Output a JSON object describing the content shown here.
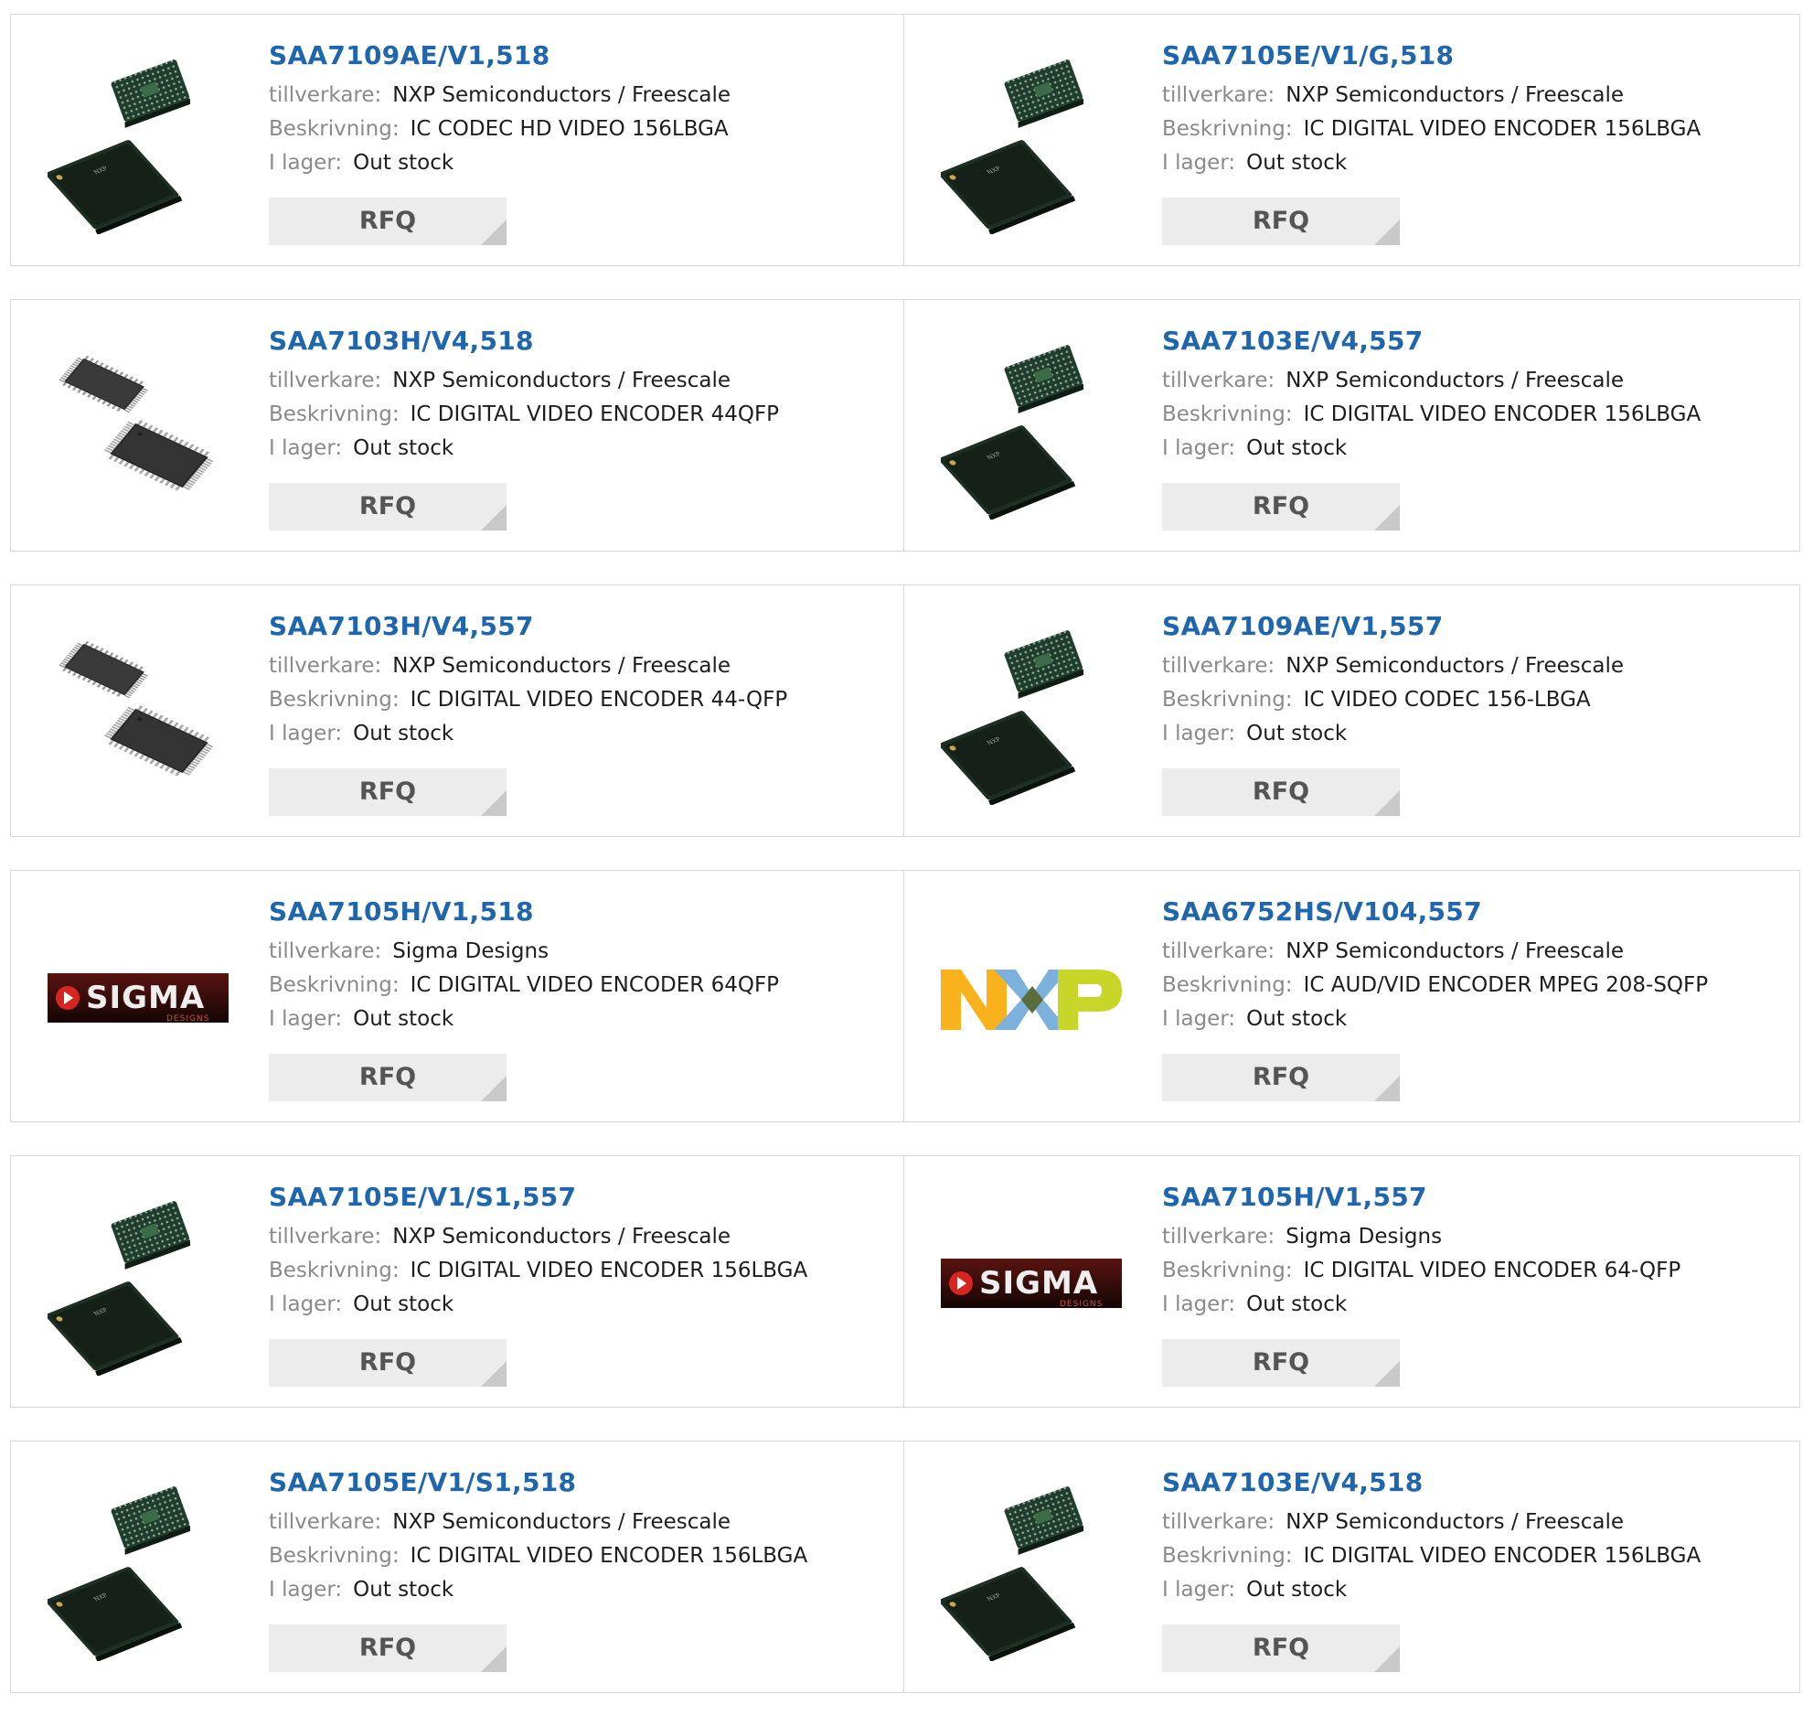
{
  "labels": {
    "manufacturer": "tillverkare:",
    "description": "Beskrivning:",
    "stock": "I lager:",
    "rfq": "RFQ"
  },
  "products": [
    {
      "part": "SAA7109AE/V1,518",
      "manufacturer": "NXP Semiconductors / Freescale",
      "description": "IC CODEC HD VIDEO 156LBGA",
      "stock": "Out stock",
      "image": "bga-chip-icon"
    },
    {
      "part": "SAA7105E/V1/G,518",
      "manufacturer": "NXP Semiconductors / Freescale",
      "description": "IC DIGITAL VIDEO ENCODER 156LBGA",
      "stock": "Out stock",
      "image": "bga-chip-icon"
    },
    {
      "part": "SAA7103H/V4,518",
      "manufacturer": "NXP Semiconductors / Freescale",
      "description": "IC DIGITAL VIDEO ENCODER 44QFP",
      "stock": "Out stock",
      "image": "qfp-chip-icon"
    },
    {
      "part": "SAA7103E/V4,557",
      "manufacturer": "NXP Semiconductors / Freescale",
      "description": "IC DIGITAL VIDEO ENCODER 156LBGA",
      "stock": "Out stock",
      "image": "bga-chip-icon"
    },
    {
      "part": "SAA7103H/V4,557",
      "manufacturer": "NXP Semiconductors / Freescale",
      "description": "IC DIGITAL VIDEO ENCODER 44-QFP",
      "stock": "Out stock",
      "image": "qfp-chip-icon"
    },
    {
      "part": "SAA7109AE/V1,557",
      "manufacturer": "NXP Semiconductors / Freescale",
      "description": "IC VIDEO CODEC 156-LBGA",
      "stock": "Out stock",
      "image": "bga-chip-icon"
    },
    {
      "part": "SAA7105H/V1,518",
      "manufacturer": "Sigma Designs",
      "description": "IC DIGITAL VIDEO ENCODER 64QFP",
      "stock": "Out stock",
      "image": "sigma-designs-logo",
      "logo_text": "SIGMA",
      "logo_subtext": "DESIGNS"
    },
    {
      "part": "SAA6752HS/V104,557",
      "manufacturer": "NXP Semiconductors / Freescale",
      "description": "IC AUD/VID ENCODER MPEG 208-SQFP",
      "stock": "Out stock",
      "image": "nxp-logo",
      "logo_text": "NXP"
    },
    {
      "part": "SAA7105E/V1/S1,557",
      "manufacturer": "NXP Semiconductors / Freescale",
      "description": "IC DIGITAL VIDEO ENCODER 156LBGA",
      "stock": "Out stock",
      "image": "bga-chip-icon"
    },
    {
      "part": "SAA7105H/V1,557",
      "manufacturer": "Sigma Designs",
      "description": "IC DIGITAL VIDEO ENCODER 64-QFP",
      "stock": "Out stock",
      "image": "sigma-designs-logo",
      "logo_text": "SIGMA",
      "logo_subtext": "DESIGNS"
    },
    {
      "part": "SAA7105E/V1/S1,518",
      "manufacturer": "NXP Semiconductors / Freescale",
      "description": "IC DIGITAL VIDEO ENCODER 156LBGA",
      "stock": "Out stock",
      "image": "bga-chip-icon"
    },
    {
      "part": "SAA7103E/V4,518",
      "manufacturer": "NXP Semiconductors / Freescale",
      "description": "IC DIGITAL VIDEO ENCODER 156LBGA",
      "stock": "Out stock",
      "image": "bga-chip-icon"
    }
  ],
  "colors": {
    "link": "#1f66ad",
    "label": "#8a8a8a",
    "rfq_bg": "#ececec",
    "border": "#d8d8d8",
    "sigma_red": "#d7261f",
    "nxp_yellow": "#f9b21b",
    "nxp_blue": "#7bb1db",
    "nxp_green": "#c8d629"
  }
}
